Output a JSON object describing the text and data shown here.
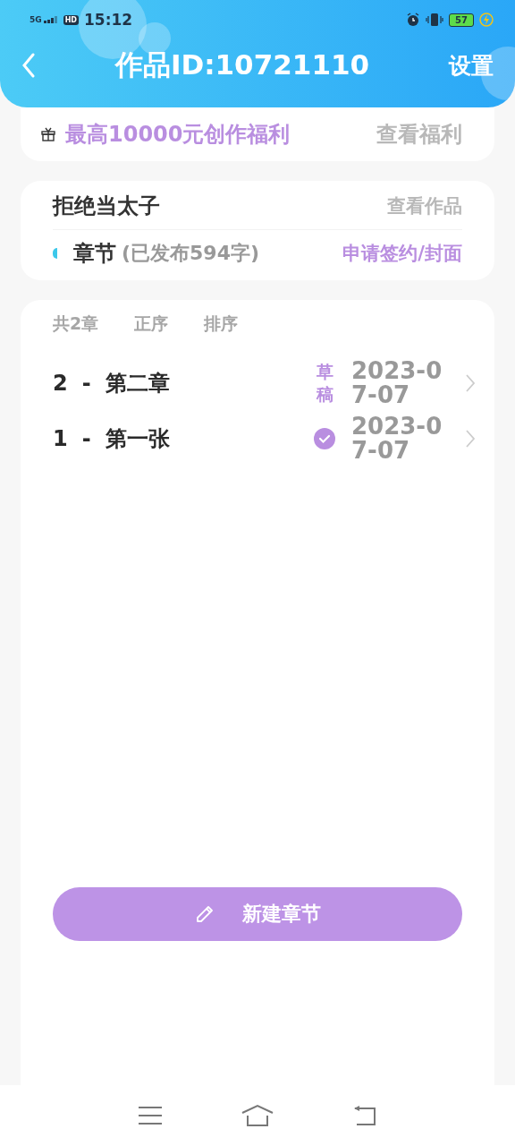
{
  "status_bar": {
    "network": "5G",
    "hd": "HD",
    "time": "15:12",
    "battery": "57"
  },
  "header": {
    "title": "作品ID:10721110",
    "action": "设置"
  },
  "bonus": {
    "text": "最高10000元创作福利",
    "link": "查看福利"
  },
  "work": {
    "title": "拒绝当太子",
    "link": "查看作品",
    "section": "章节",
    "published": "(已发布594字)",
    "action": "申请签约/封面"
  },
  "toolbar": {
    "count": "共2章",
    "order": "正序",
    "sort": "排序"
  },
  "chapters": [
    {
      "number": "2",
      "separator": "-",
      "title": "第二章",
      "kind": "draft",
      "status_label": "草稿",
      "date": "2023-07-07"
    },
    {
      "number": "1",
      "separator": "-",
      "title": "第一张",
      "kind": "published",
      "date": "2023-07-07"
    }
  ],
  "new_button": "新建章节"
}
